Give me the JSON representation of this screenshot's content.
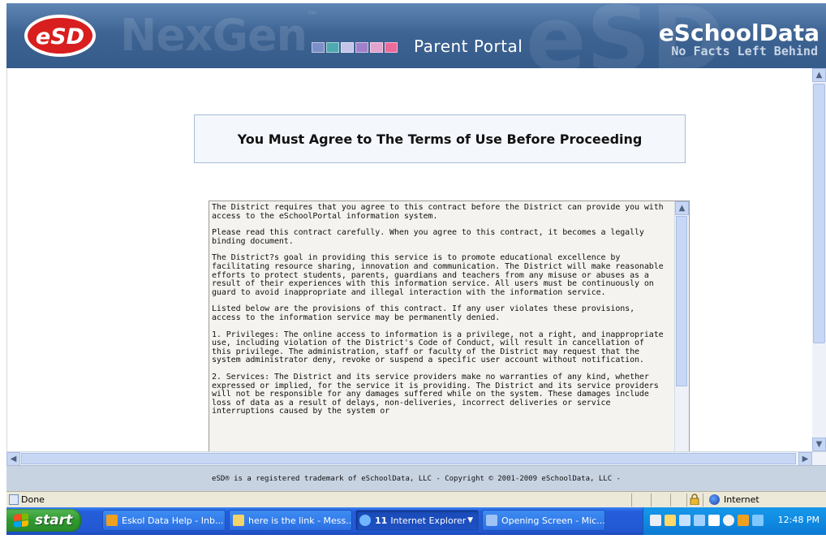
{
  "header": {
    "logo_text": "eSD",
    "ghost_text": "NexGen",
    "ghost_text_sup": "™",
    "portal_title": "Parent Portal",
    "brand": "eSchoolData",
    "tagline": "No Facts Left Behind",
    "square_colors": [
      "#7d8fc9",
      "#4fa9b1",
      "#c3c4e6",
      "#a080c8",
      "#e3a3cf",
      "#ec6b9a"
    ]
  },
  "terms": {
    "heading": "You Must Agree to The Terms of Use Before Proceeding",
    "paragraphs": [
      "The District requires that you agree to this contract before the District can provide you with access to the eSchoolPortal information system.",
      "Please read this contract carefully. When you agree to this contract, it becomes a legally binding document.",
      "The District?s goal in providing this service is to promote educational excellence by facilitating resource sharing, innovation and communication.  The District will make reasonable efforts to protect students, parents, guardians and teachers from any misuse or abuses as a result of their experiences with this information service.  All users must be continuously on guard to avoid inappropriate and illegal interaction with the information service.",
      "Listed below are the provisions of this contract.  If any user violates these provisions, access to the information service may be permanently denied.",
      "1. Privileges: The online access to information is a privilege, not a right, and inappropriate use, including violation of the District's Code of Conduct, will result in cancellation of this privilege.  The administration, staff or faculty of the District may request that the system administrator deny, revoke or suspend a specific user account without notification.",
      "2. Services: The District and its service providers make no warranties of any kind, whether expressed or implied, for the service it is providing.  The District and its service providers will not be responsible for any damages suffered while on the system. These damages include loss of data as a result of delays, non-deliveries, incorrect deliveries or service interruptions caused by the system or"
    ]
  },
  "footer": {
    "copyright": "eSD® is a registered trademark of eSchoolData, LLC - Copyright © 2001-2009 eSchoolData, LLC -"
  },
  "statusbar": {
    "status": "Done",
    "zone": "Internet"
  },
  "taskbar": {
    "start_label": "start",
    "tasks": [
      {
        "label": "Eskol Data Help - Inb...",
        "icon_color": "#f0a020"
      },
      {
        "label": "here is the link - Mess...",
        "icon_color": "#f3d46a"
      },
      {
        "count": "11",
        "label": "Internet Explorer",
        "icon_color": "#6fb6ff"
      },
      {
        "label": "Opening Screen - Mic...",
        "icon_color": "#9fc3f5"
      }
    ],
    "clock": "12:48 PM"
  }
}
